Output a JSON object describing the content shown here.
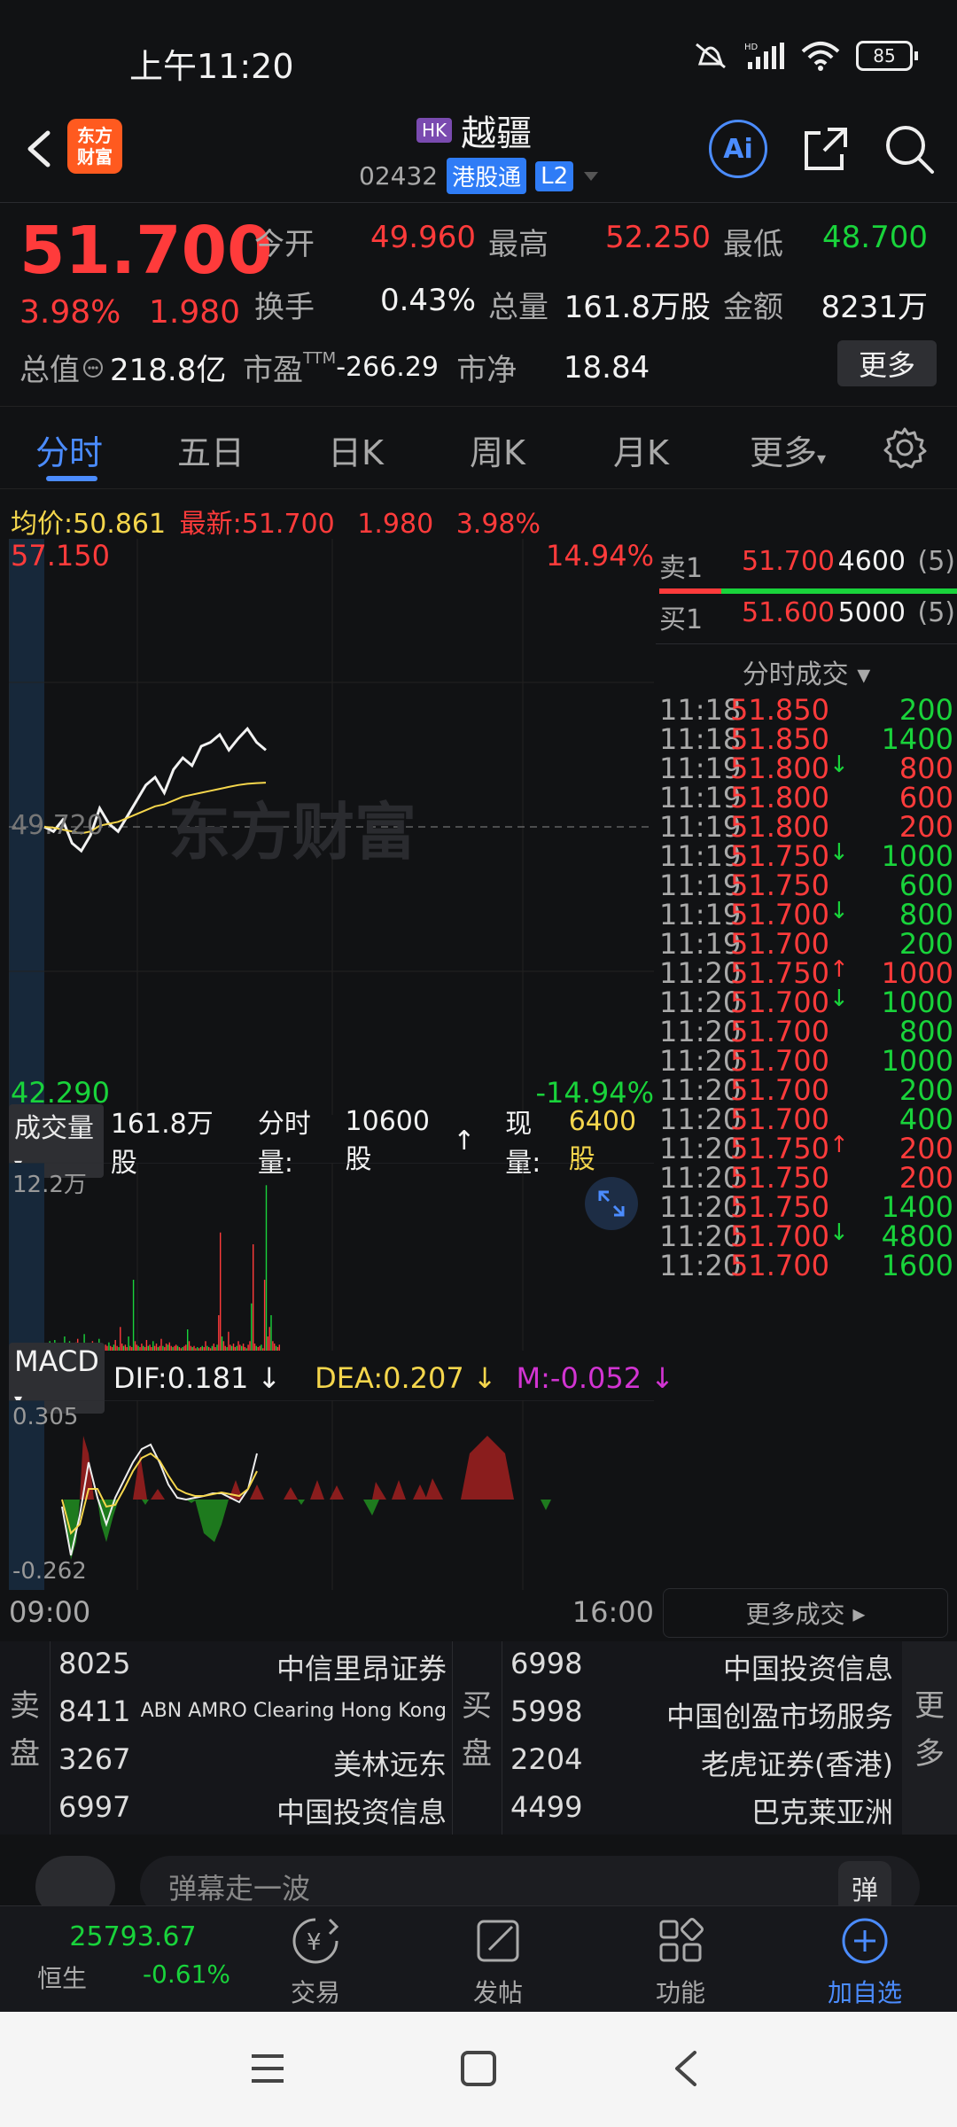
{
  "status": {
    "time": "上午11:20",
    "battery": "85"
  },
  "header": {
    "logo_text": "东方财富",
    "market_tag": "HK",
    "name": "越疆",
    "code": "02432",
    "connect_tag": "港股通",
    "level_tag": "L2",
    "ai_label": "Ai"
  },
  "quote": {
    "price": "51.700",
    "pct": "3.98%",
    "change": "1.980",
    "labels": {
      "open": "今开",
      "high": "最高",
      "low": "最低",
      "turnover": "换手",
      "volume": "总量",
      "amount": "金额",
      "mktcap": "总值",
      "pe": "市盈",
      "pe_sup": "TTM",
      "pb": "市净"
    },
    "open": "49.960",
    "high": "52.250",
    "low": "48.700",
    "turnover_rate": "0.43%",
    "volume": "161.8万股",
    "amount": "8231万",
    "mktcap": "218.8亿",
    "pe": "-266.29",
    "pb": "18.84",
    "more": "更多"
  },
  "tabs": [
    "分时",
    "五日",
    "日K",
    "周K",
    "月K",
    "更多"
  ],
  "intraday": {
    "avg_label": "均价:",
    "avg": "50.861",
    "latest_label": "最新:",
    "latest": "51.700",
    "change": "1.980",
    "pct": "3.98%",
    "y_max": "57.150",
    "y_min": "42.290",
    "pct_max": "14.94%",
    "pct_min": "-14.94%",
    "ref": "49.720",
    "watermark": "东方财富"
  },
  "orderbook": [
    {
      "label": "卖1",
      "price": "51.700",
      "qty": "4600",
      "count": "(5)"
    },
    {
      "label": "买1",
      "price": "51.600",
      "qty": "5000",
      "count": "(5)"
    }
  ],
  "trades_title": "分时成交",
  "trades": [
    {
      "t": "11:18",
      "p": "51.850",
      "arrow": "",
      "v": "200",
      "vc": "green"
    },
    {
      "t": "11:18",
      "p": "51.850",
      "arrow": "",
      "v": "1400",
      "vc": "green"
    },
    {
      "t": "11:19",
      "p": "51.800",
      "arrow": "↓",
      "v": "800",
      "vc": "red"
    },
    {
      "t": "11:19",
      "p": "51.800",
      "arrow": "",
      "v": "600",
      "vc": "red"
    },
    {
      "t": "11:19",
      "p": "51.800",
      "arrow": "",
      "v": "200",
      "vc": "red"
    },
    {
      "t": "11:19",
      "p": "51.750",
      "arrow": "↓",
      "v": "1000",
      "vc": "green"
    },
    {
      "t": "11:19",
      "p": "51.750",
      "arrow": "",
      "v": "600",
      "vc": "green"
    },
    {
      "t": "11:19",
      "p": "51.700",
      "arrow": "↓",
      "v": "800",
      "vc": "green"
    },
    {
      "t": "11:19",
      "p": "51.700",
      "arrow": "",
      "v": "200",
      "vc": "green"
    },
    {
      "t": "11:20",
      "p": "51.750",
      "arrow": "↑",
      "v": "1000",
      "vc": "red"
    },
    {
      "t": "11:20",
      "p": "51.700",
      "arrow": "↓",
      "v": "1000",
      "vc": "green"
    },
    {
      "t": "11:20",
      "p": "51.700",
      "arrow": "",
      "v": "800",
      "vc": "green"
    },
    {
      "t": "11:20",
      "p": "51.700",
      "arrow": "",
      "v": "1000",
      "vc": "green"
    },
    {
      "t": "11:20",
      "p": "51.700",
      "arrow": "",
      "v": "200",
      "vc": "green"
    },
    {
      "t": "11:20",
      "p": "51.700",
      "arrow": "",
      "v": "400",
      "vc": "green"
    },
    {
      "t": "11:20",
      "p": "51.750",
      "arrow": "↑",
      "v": "200",
      "vc": "red"
    },
    {
      "t": "11:20",
      "p": "51.750",
      "arrow": "",
      "v": "200",
      "vc": "red"
    },
    {
      "t": "11:20",
      "p": "51.750",
      "arrow": "",
      "v": "1400",
      "vc": "green"
    },
    {
      "t": "11:20",
      "p": "51.700",
      "arrow": "↓",
      "v": "4800",
      "vc": "green"
    },
    {
      "t": "11:20",
      "p": "51.700",
      "arrow": "",
      "v": "1600",
      "vc": "green"
    }
  ],
  "more_trades": "更多成交",
  "volume": {
    "label": "成交量",
    "total": "161.8万股",
    "period_label": "分时量:",
    "period": "10600股",
    "arrow": "↑",
    "now_label": "现量:",
    "now": "6400股",
    "max": "12.2万"
  },
  "macd": {
    "label": "MACD",
    "dif_label": "DIF:",
    "dif": "0.181",
    "dea_label": "DEA:",
    "dea": "0.207",
    "m_label": "M:",
    "m": "-0.052",
    "arrow_down": "↓",
    "top": "0.305",
    "bottom": "-0.262"
  },
  "time_axis": {
    "start": "09:00",
    "end": "16:00"
  },
  "brokers": {
    "sell_label": "卖盘",
    "buy_label": "买盘",
    "more_label": "更多",
    "sell": [
      {
        "id": "8025",
        "name": "中信里昂证券"
      },
      {
        "id": "8411",
        "name": "ABN AMRO Clearing Hong Kong"
      },
      {
        "id": "3267",
        "name": "美林远东"
      },
      {
        "id": "6997",
        "name": "中国投资信息"
      }
    ],
    "buy": [
      {
        "id": "6998",
        "name": "中国投资信息"
      },
      {
        "id": "5998",
        "name": "中国创盈市场服务"
      },
      {
        "id": "2204",
        "name": "老虎证券(香港)"
      },
      {
        "id": "4499",
        "name": "巴克莱亚洲"
      }
    ]
  },
  "danmu": {
    "placeholder": "弹幕走一波",
    "btn": "弹"
  },
  "bottom": {
    "index_value": "25793.67",
    "index_name": "恒生",
    "index_pct": "-0.61%",
    "items": [
      "交易",
      "发帖",
      "功能",
      "加自选"
    ]
  },
  "colors": {
    "up": "#ff3b3b",
    "down": "#19d33b",
    "accent": "#4b8cff",
    "avg": "#f5d64c",
    "dea": "#f5d64c",
    "m": "#d234d2"
  },
  "chart_data": {
    "type": "line",
    "title": "",
    "xlabel": "",
    "ylabel": "",
    "ylim": [
      42.29,
      57.15
    ],
    "x_range": [
      "09:00",
      "16:00"
    ],
    "ref_price": 49.72,
    "series": [
      {
        "values": [
          49.72,
          49.6,
          49.9,
          49.3,
          49.1,
          49.5,
          50.2,
          49.8,
          49.6,
          50.0,
          50.4,
          50.8,
          51.0,
          50.6,
          51.2,
          51.5,
          51.3,
          51.8,
          51.9,
          52.1,
          51.7,
          52.0,
          52.25,
          51.9,
          51.7
        ]
      },
      {
        "values": [
          49.72,
          49.7,
          49.65,
          49.6,
          49.55,
          49.6,
          49.75,
          49.8,
          49.85,
          49.95,
          50.05,
          50.15,
          50.25,
          50.3,
          50.4,
          50.5,
          50.55,
          50.6,
          50.65,
          50.7,
          50.75,
          50.8,
          50.83,
          50.85,
          50.861
        ]
      }
    ]
  }
}
